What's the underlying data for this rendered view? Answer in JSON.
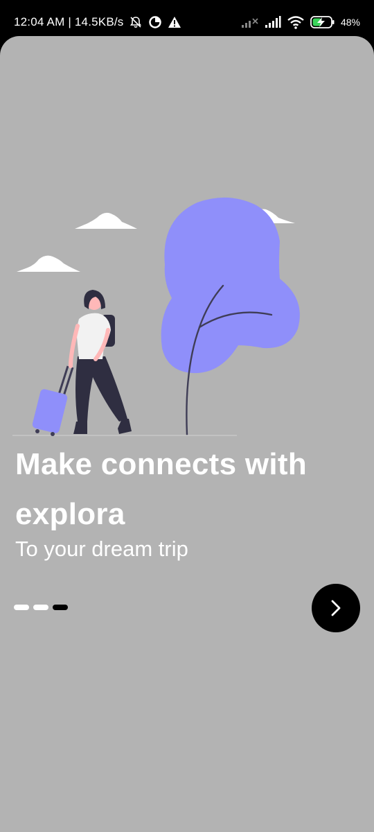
{
  "status_bar": {
    "time_speed": "12:04 AM | 14.5KB/s",
    "battery_percent": "48%",
    "icons": [
      "bell-muted-icon",
      "data-saver-icon",
      "warning-icon",
      "signal-strength-icon",
      "signal-strength-icon",
      "wifi-icon",
      "battery-charging-icon"
    ]
  },
  "onboarding": {
    "title": "Make connects with explora",
    "subtitle": "To your dream trip",
    "page_indicator": {
      "total": 3,
      "active": 3
    },
    "next_icon": "chevron-right-icon"
  },
  "colors": {
    "background": "#b3b3b3",
    "accent": "#8f8ffa",
    "text": "#ffffff",
    "button": "#000000"
  }
}
